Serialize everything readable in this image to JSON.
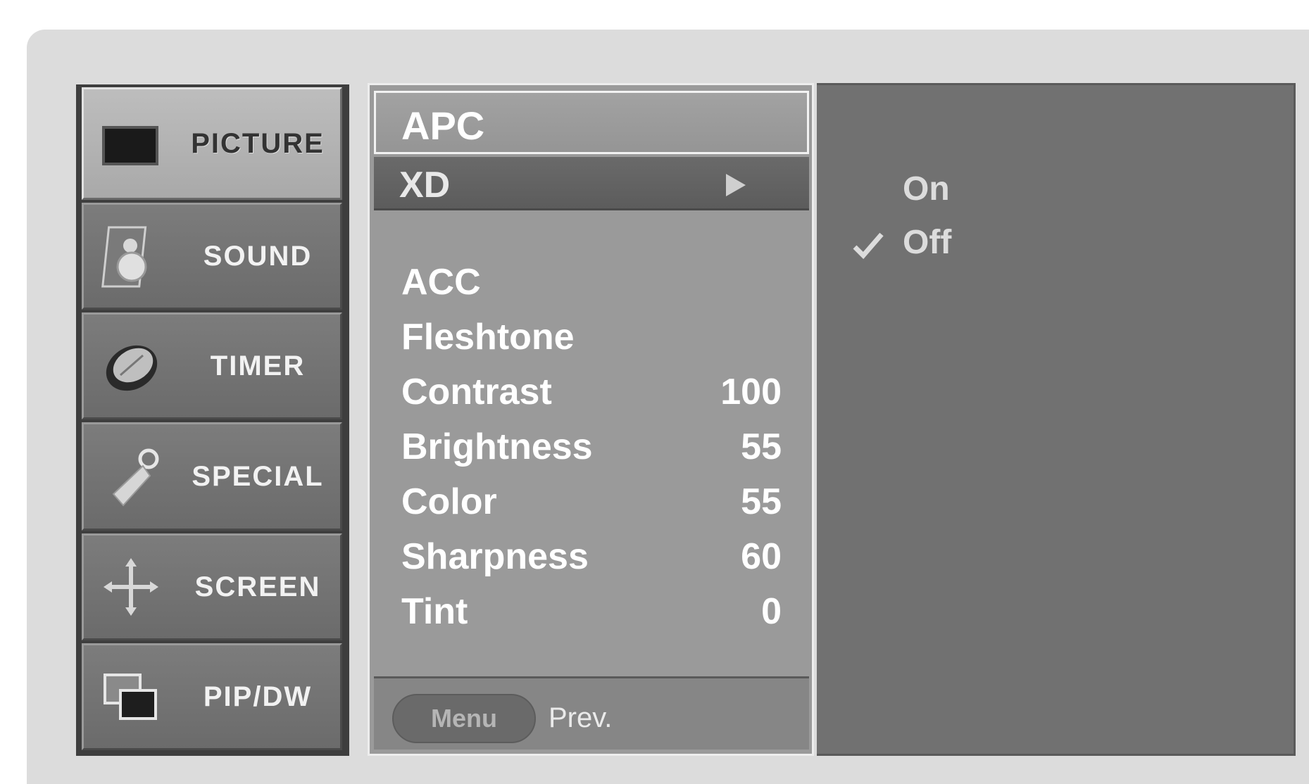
{
  "sidebar": {
    "items": [
      {
        "label": "PICTURE",
        "icon": "picture-icon",
        "active": true
      },
      {
        "label": "SOUND",
        "icon": "sound-icon"
      },
      {
        "label": "TIMER",
        "icon": "timer-icon"
      },
      {
        "label": "SPECIAL",
        "icon": "special-icon"
      },
      {
        "label": "SCREEN",
        "icon": "screen-icon"
      },
      {
        "label": "PIP/DW",
        "icon": "pip-icon"
      }
    ]
  },
  "menu": {
    "title": "APC",
    "highlighted": {
      "label": "XD"
    },
    "items": [
      {
        "label": "ACC",
        "value": ""
      },
      {
        "label": "Fleshtone",
        "value": ""
      },
      {
        "label": "Contrast",
        "value": "100"
      },
      {
        "label": "Brightness",
        "value": "55"
      },
      {
        "label": "Color",
        "value": "55"
      },
      {
        "label": "Sharpness",
        "value": "60"
      },
      {
        "label": "Tint",
        "value": "0"
      }
    ],
    "footer": {
      "button": "Menu",
      "hint": "Prev."
    }
  },
  "submenu": {
    "options": [
      {
        "label": "On",
        "checked": false
      },
      {
        "label": "Off",
        "checked": true
      }
    ]
  },
  "colors": {
    "frame": "#dcdcdc",
    "menu_bg": "#9a9a9a",
    "highlight": "#5c5c5c",
    "panel": "#717171"
  }
}
